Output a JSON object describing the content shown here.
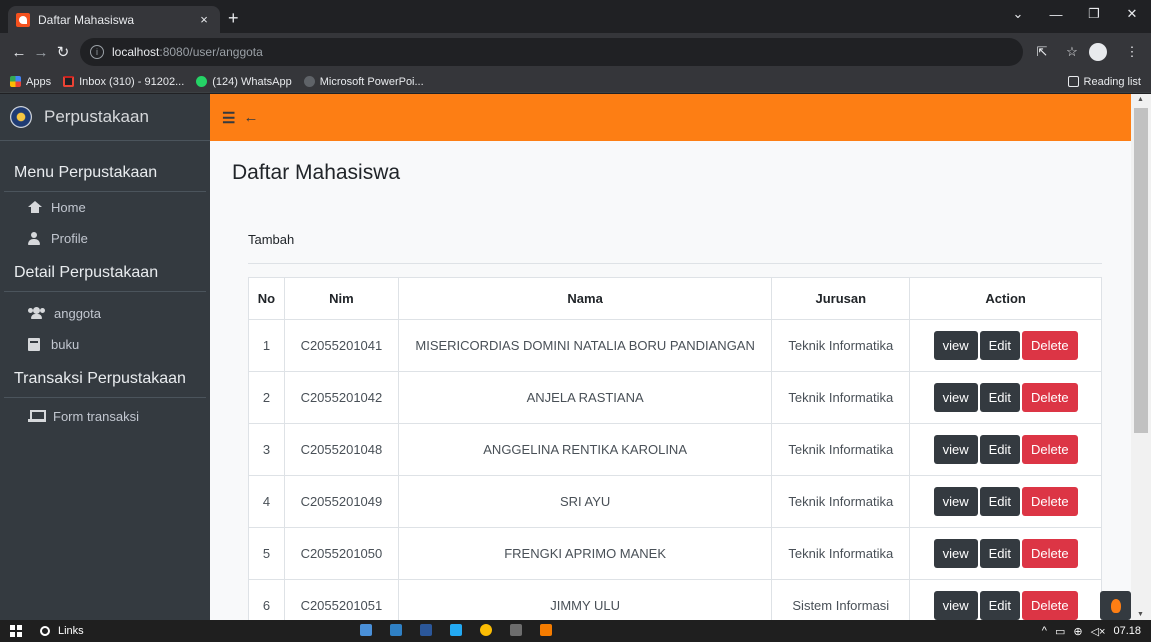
{
  "browser": {
    "tab_title": "Daftar Mahasiswa",
    "tab_close": "×",
    "new_tab": "+",
    "url_host": "localhost",
    "url_path": ":8080/user/anggota",
    "bookmarks": [
      {
        "label": "Apps",
        "icon": "apps-icon"
      },
      {
        "label": "Inbox (310) - 91202...",
        "icon": "gmail-icon"
      },
      {
        "label": "(124) WhatsApp",
        "icon": "whatsapp-icon"
      },
      {
        "label": "Microsoft PowerPoi...",
        "icon": "powerpoint-icon"
      }
    ],
    "reading_list": "Reading list"
  },
  "sidebar": {
    "brand": "Perpustakaan",
    "sections": [
      {
        "header": "Menu Perpustakaan",
        "items": [
          {
            "label": "Home",
            "icon": "home-icon"
          },
          {
            "label": "Profile",
            "icon": "user-icon"
          }
        ]
      },
      {
        "header": "Detail Perpustakaan",
        "items": [
          {
            "label": "anggota",
            "icon": "users-icon"
          },
          {
            "label": "buku",
            "icon": "book-icon"
          }
        ]
      },
      {
        "header": "Transaksi Perpustakaan",
        "items": [
          {
            "label": "Form transaksi",
            "icon": "laptop-icon"
          }
        ]
      }
    ]
  },
  "navbar": {
    "menu_glyph": "☰",
    "back_glyph": "←"
  },
  "main": {
    "title": "Daftar Mahasiswa",
    "tambah": "Tambah",
    "table": {
      "headers": [
        "No",
        "Nim",
        "Nama",
        "Jurusan",
        "Action"
      ],
      "rows": [
        [
          "1",
          "C2055201041",
          "MISERICORDIAS DOMINI NATALIA BORU PANDIANGAN",
          "Teknik Informatika"
        ],
        [
          "2",
          "C2055201042",
          "ANJELA RASTIANA",
          "Teknik Informatika"
        ],
        [
          "3",
          "C2055201048",
          "ANGGELINA RENTIKA KAROLINA",
          "Teknik Informatika"
        ],
        [
          "4",
          "C2055201049",
          "SRI AYU",
          "Teknik Informatika"
        ],
        [
          "5",
          "C2055201050",
          "FRENGKI APRIMO MANEK",
          "Teknik Informatika"
        ],
        [
          "6",
          "C2055201051",
          "JIMMY ULU",
          "Sistem Informasi"
        ]
      ],
      "actions": {
        "view": "view",
        "edit": "Edit",
        "delete": "Delete"
      }
    }
  },
  "taskbar": {
    "search_label": "Links",
    "time": "07.18"
  },
  "colors": {
    "navbar": "#fd7e14",
    "sidebar": "#343a40",
    "delete": "#dc3545",
    "dark_button": "#343a40"
  }
}
